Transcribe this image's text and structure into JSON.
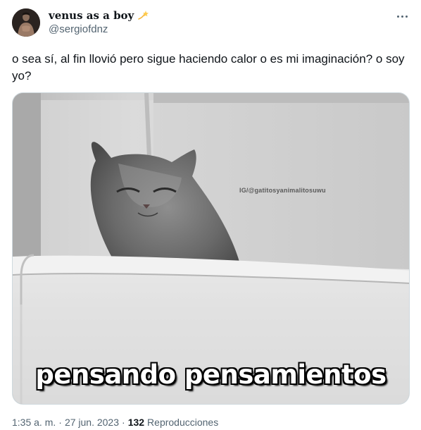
{
  "author": {
    "display_name": "venus as a boy",
    "emoji": "dizzy-star-emoji",
    "handle": "@sergiofdnz"
  },
  "tweet": {
    "text": "o sea sí, al fin llovió pero sigue haciendo calor o es mi imaginación? o soy yo?"
  },
  "media": {
    "watermark": "IG/@gatitosyanimalitosuwu",
    "caption": "pensando pensamientos"
  },
  "meta": {
    "time": "1:35 a. m.",
    "separator": "·",
    "date": "27 jun. 2023",
    "views_count": "132",
    "views_label": "Reproducciones"
  },
  "colors": {
    "text_primary": "#0f1419",
    "text_secondary": "#536471",
    "border": "#cfd9de"
  },
  "icons": {
    "more": "more-horizontal-icon"
  }
}
